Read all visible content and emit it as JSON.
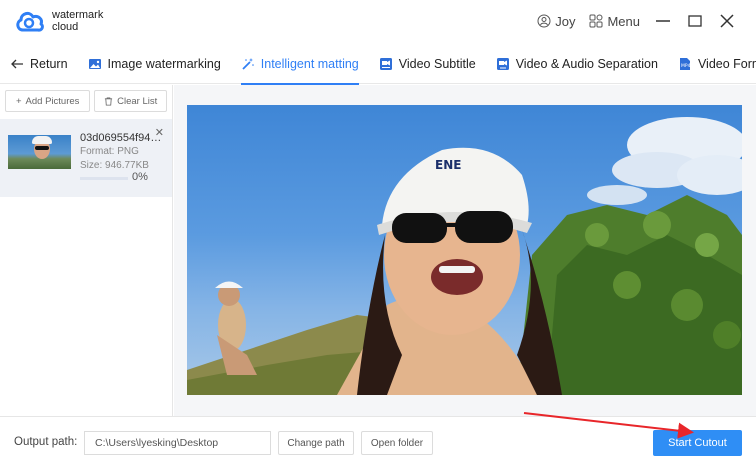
{
  "app": {
    "logo_line1": "watermark",
    "logo_line2": "cloud",
    "user_name": "Joy",
    "menu_label": "Menu"
  },
  "tabs": [
    {
      "label": "Return",
      "icon": "arrow-left-icon"
    },
    {
      "label": "Image watermarking",
      "icon": "image-icon"
    },
    {
      "label": "Intelligent matting",
      "icon": "magic-wand-icon",
      "active": true
    },
    {
      "label": "Video Subtitle",
      "icon": "video-subtitle-icon"
    },
    {
      "label": "Video & Audio Separation",
      "icon": "video-audio-icon"
    },
    {
      "label": "Video Form",
      "icon": "mp4-icon"
    }
  ],
  "left_panel": {
    "add_label": "Add Pictures",
    "clear_label": "Clear List",
    "file": {
      "name": "03d069554f947d...",
      "format": "Format:  PNG",
      "size": "Size:  946.77KB",
      "progress_percent": "0%",
      "progress_value": 0
    }
  },
  "bottom": {
    "output_label": "Output path:",
    "output_value": "C:\\Users\\lyesking\\Desktop",
    "change_path": "Change path",
    "open_folder": "Open folder",
    "start": "Start Cutout"
  },
  "colors": {
    "accent": "#2f7ff5",
    "start_button": "#2f8ef5",
    "annotation_arrow": "#e8262a"
  }
}
